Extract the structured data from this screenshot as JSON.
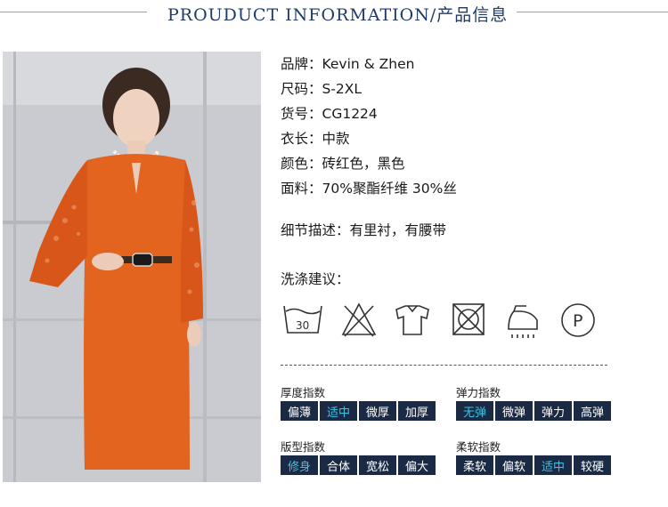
{
  "header": {
    "title": "PROUDUCT INFORMATION/产品信息"
  },
  "colors": {
    "title": "#1f3a6b",
    "chip_bg": "#1b2a44",
    "chip_selected_text": "#39c4e6",
    "dress": "#e2641f"
  },
  "product": {
    "rows": [
      "品牌：Kevin & Zhen",
      "尺码：S-2XL",
      "货号：CG1224",
      "衣长：中款",
      "颜色：砖红色，黑色",
      "面料：70%聚酯纤维 30%丝"
    ],
    "detail": "细节描述：有里衬，有腰带"
  },
  "wash": {
    "title": "洗涤建议：",
    "icons": [
      "wash-30-icon",
      "no-bleach-icon",
      "hang-dry-icon",
      "no-tumble-dry-icon",
      "iron-icon",
      "professional-dry-clean-icon"
    ],
    "temp_label": "30",
    "dryclean_label": "P"
  },
  "indexes": [
    {
      "title": "厚度指数",
      "options": [
        "偏薄",
        "适中",
        "微厚",
        "加厚"
      ],
      "selected": 1
    },
    {
      "title": "弹力指数",
      "options": [
        "无弹",
        "微弹",
        "弹力",
        "高弹"
      ],
      "selected": 0
    },
    {
      "title": "版型指数",
      "options": [
        "修身",
        "合体",
        "宽松",
        "偏大"
      ],
      "selected": 0
    },
    {
      "title": "柔软指数",
      "options": [
        "柔软",
        "偏软",
        "适中",
        "较硬"
      ],
      "selected": 2
    }
  ]
}
